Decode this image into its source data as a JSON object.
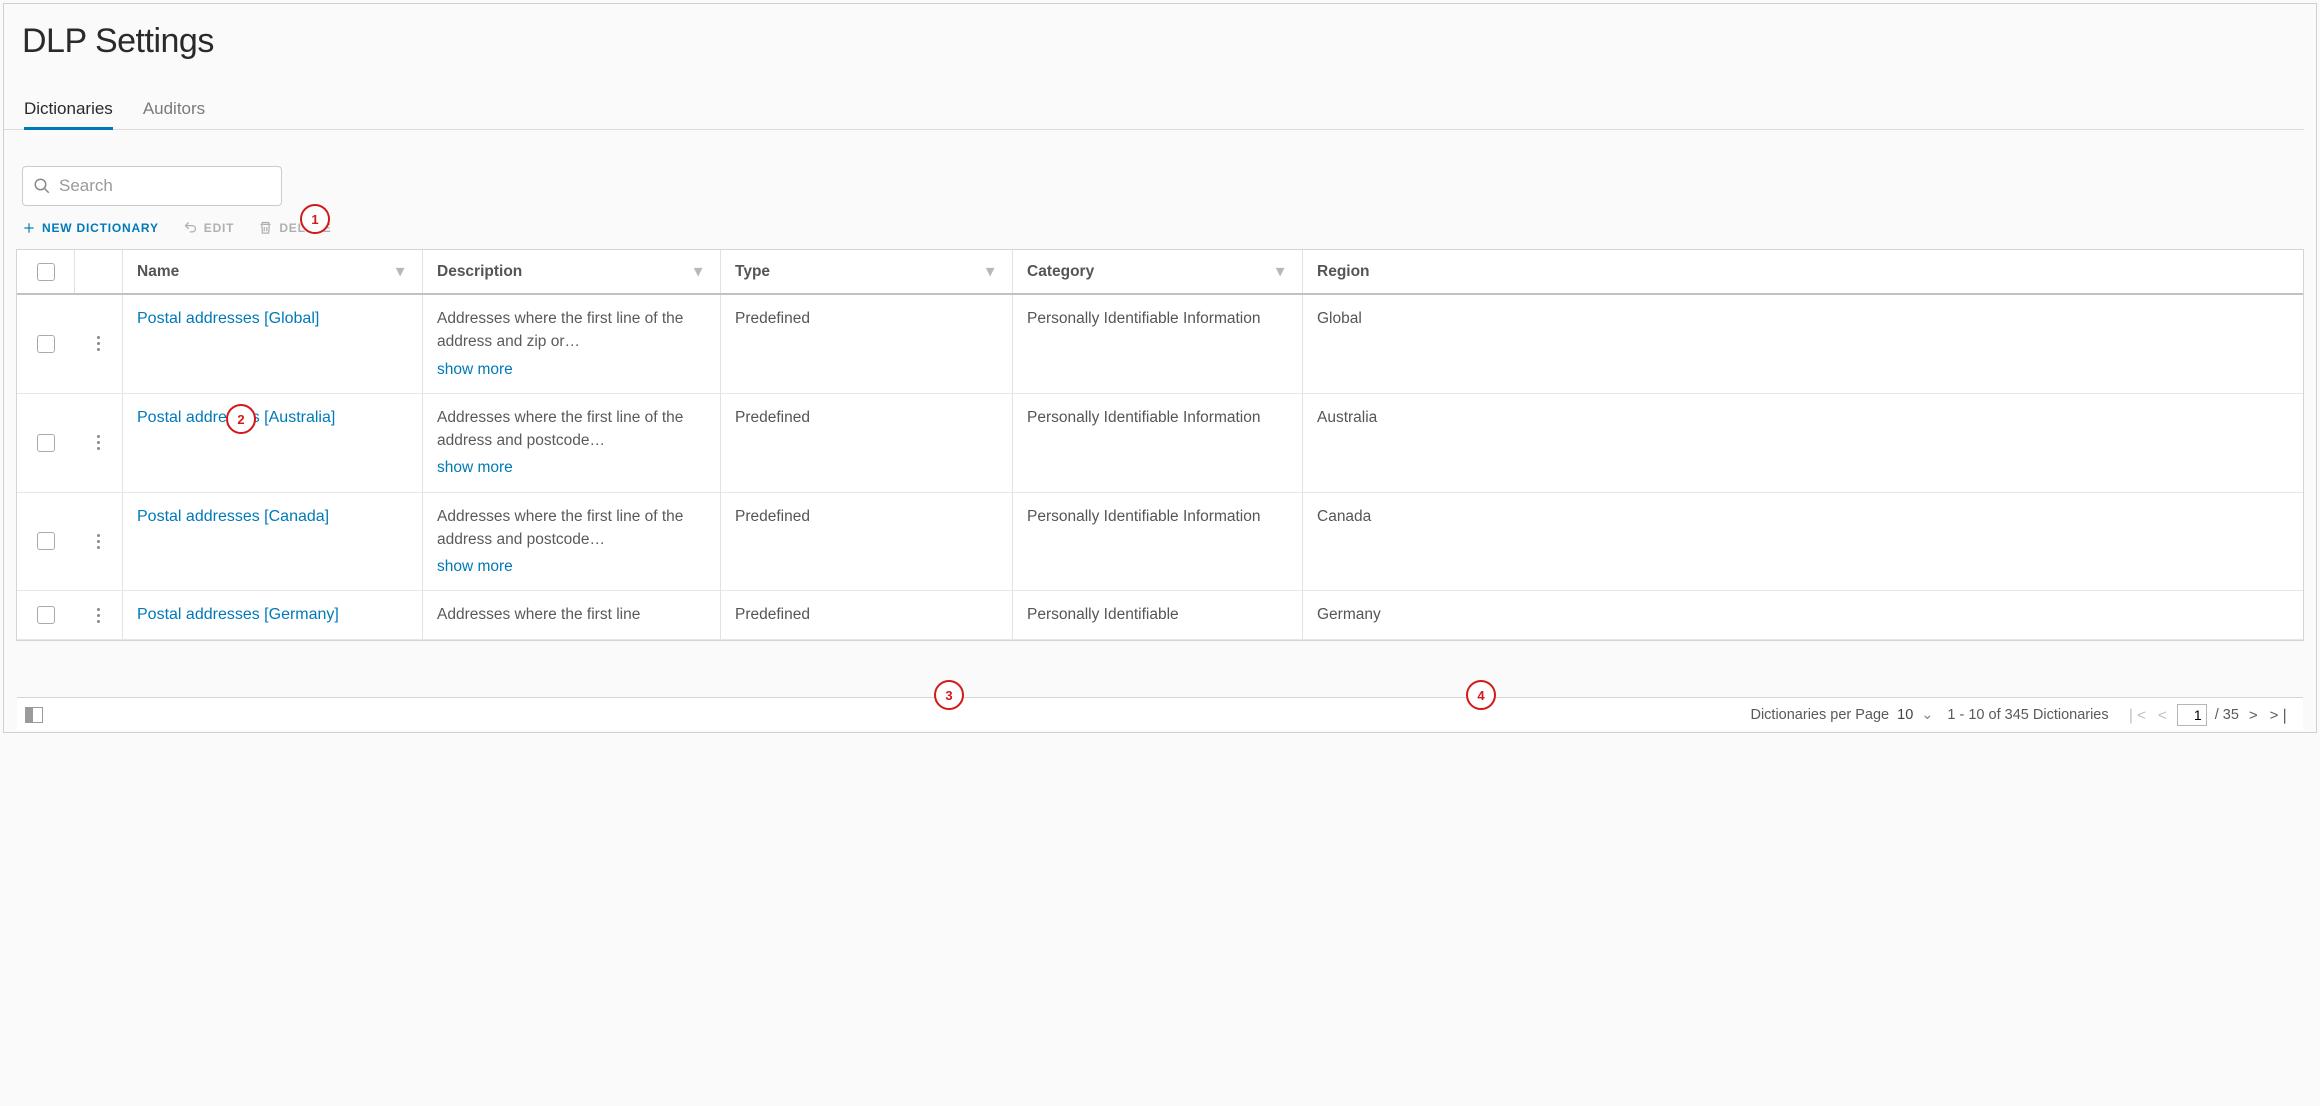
{
  "title": "DLP Settings",
  "tabs": [
    {
      "label": "Dictionaries",
      "active": true
    },
    {
      "label": "Auditors",
      "active": false
    }
  ],
  "search": {
    "placeholder": "Search"
  },
  "actions": {
    "new": "NEW DICTIONARY",
    "edit": "EDIT",
    "delete": "DELETE"
  },
  "columns": {
    "name": "Name",
    "description": "Description",
    "type": "Type",
    "category": "Category",
    "region": "Region"
  },
  "rows": [
    {
      "name": "Postal addresses [Global]",
      "desc": "Addresses where the first line of the address and zip or…",
      "type": "Predefined",
      "category": "Personally Identifiable Information",
      "region": "Global"
    },
    {
      "name": "Postal addresses [Australia]",
      "desc": "Addresses where the first line of the address and postcode…",
      "type": "Predefined",
      "category": "Personally Identifiable Information",
      "region": "Australia"
    },
    {
      "name": "Postal addresses [Canada]",
      "desc": "Addresses where the first line of the address and postcode…",
      "type": "Predefined",
      "category": "Personally Identifiable Information",
      "region": "Canada"
    },
    {
      "name": "Postal addresses [Germany]",
      "desc": "Addresses where the first line",
      "type": "Predefined",
      "category": "Personally Identifiable",
      "region": "Germany"
    }
  ],
  "show_more": "show more",
  "footer": {
    "per_page_label": "Dictionaries per Page",
    "per_page_value": "10",
    "range": "1 - 10 of 345 Dictionaries",
    "page": "1",
    "total_pages": "/ 35"
  },
  "callouts": {
    "c1": "1",
    "c2": "2",
    "c3": "3",
    "c4": "4"
  }
}
